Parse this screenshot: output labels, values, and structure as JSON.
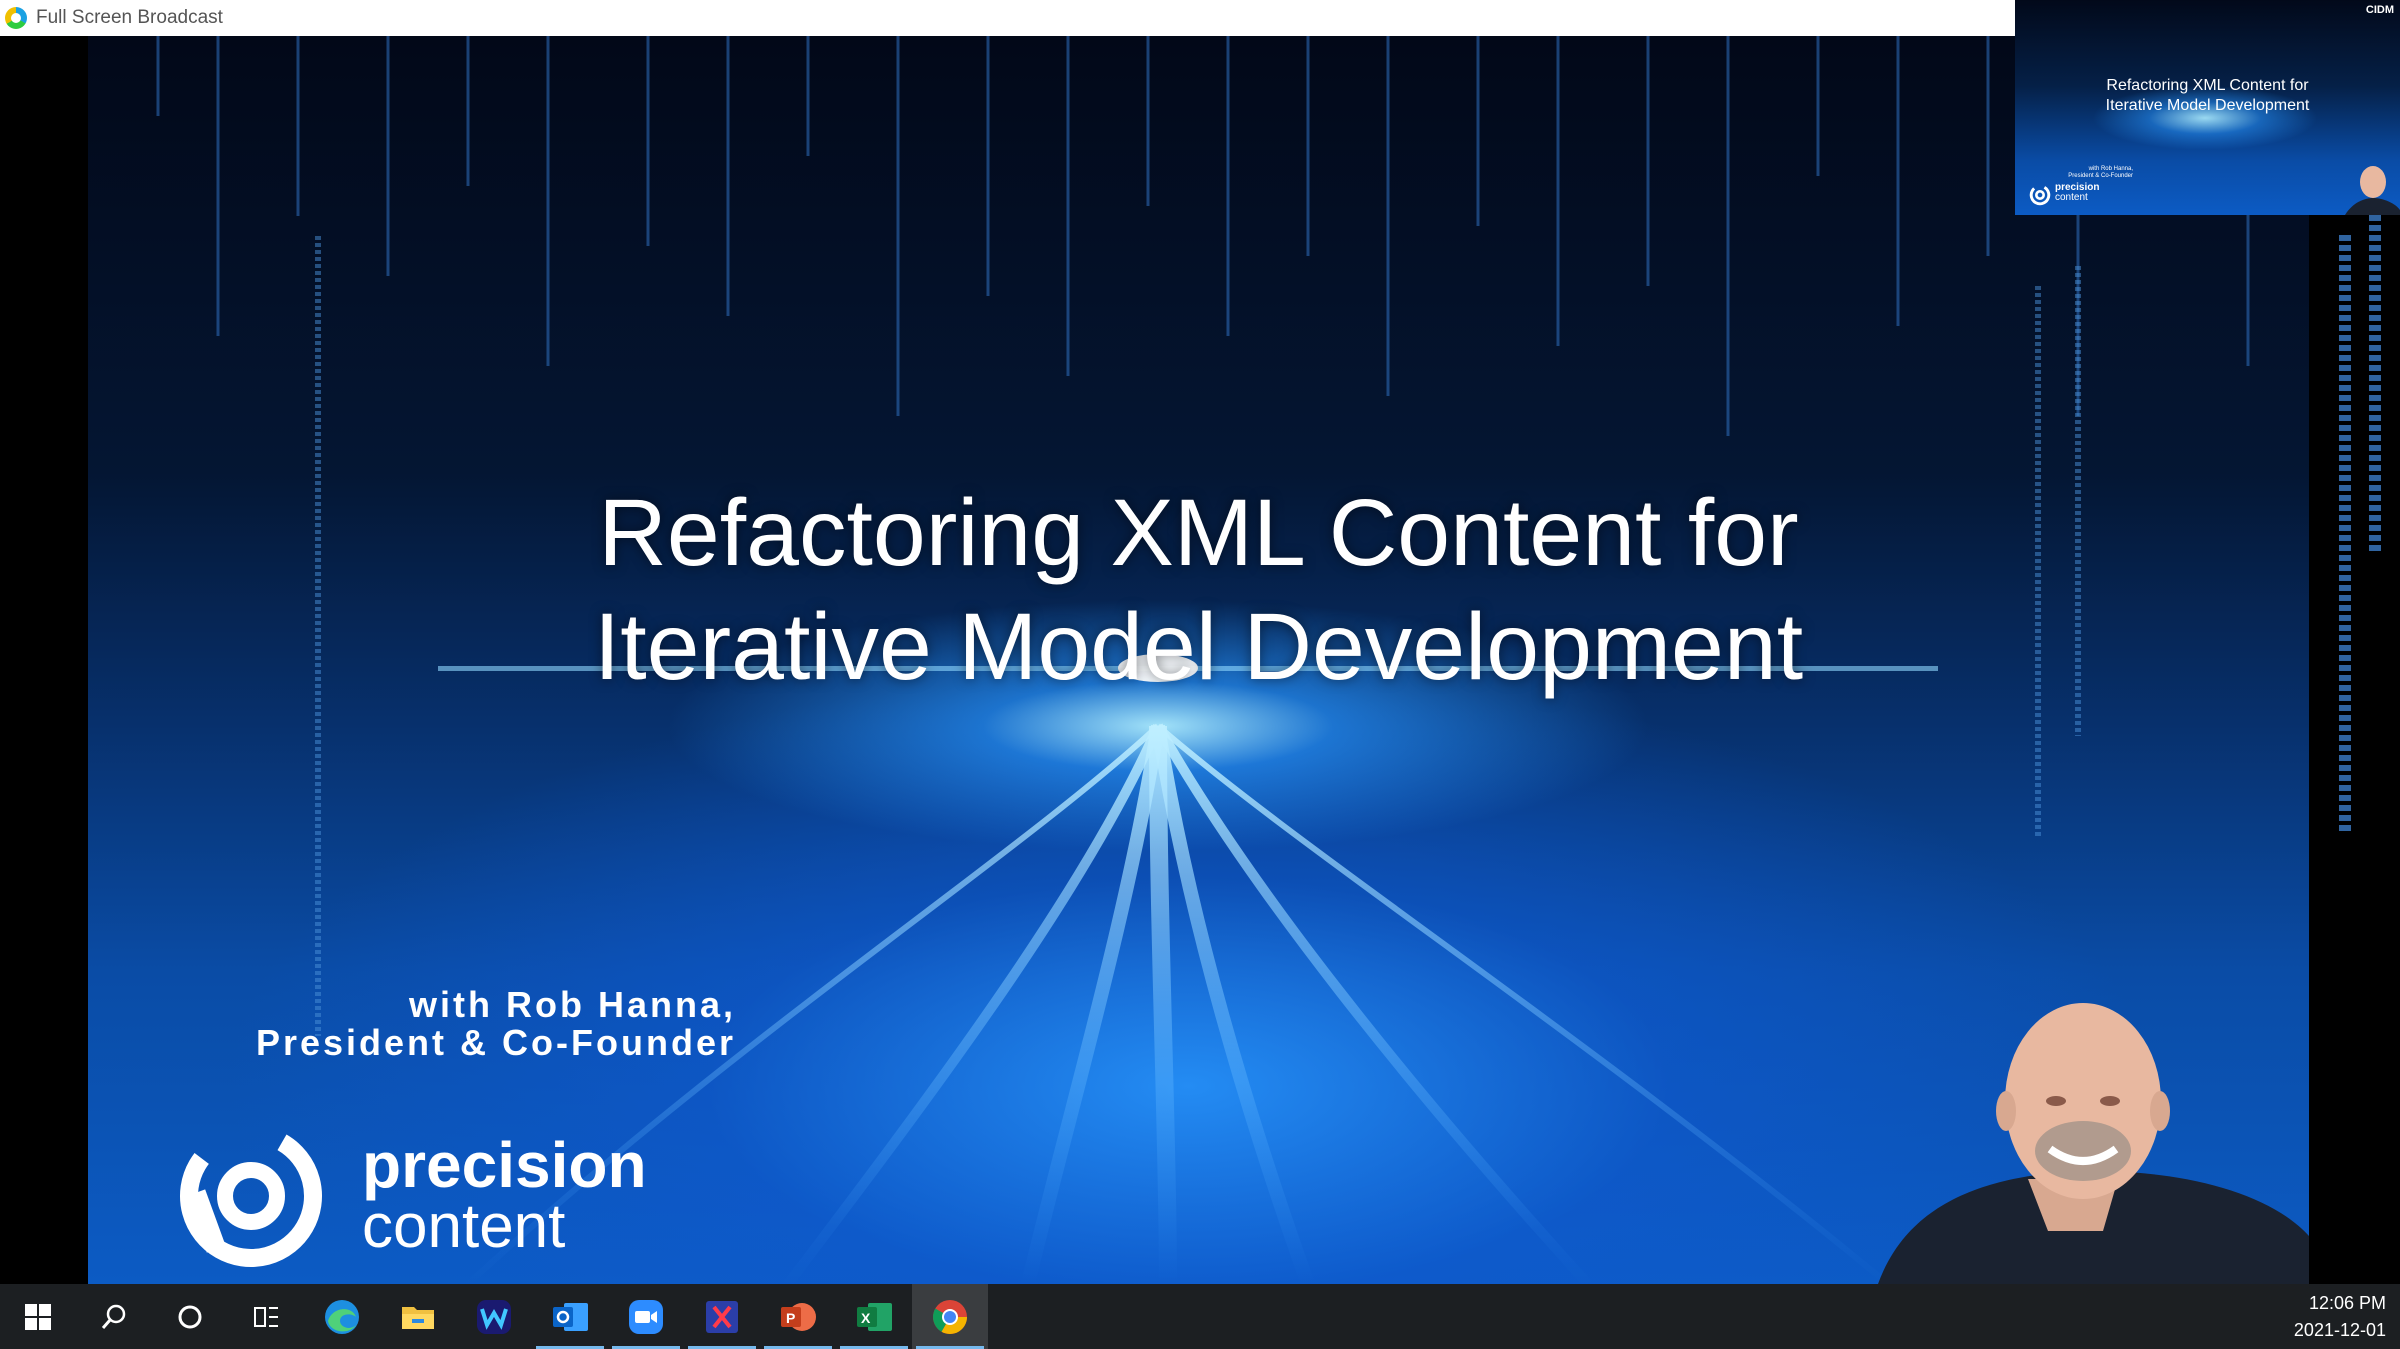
{
  "window": {
    "title": "Full Screen Broadcast"
  },
  "slide": {
    "title_line1": "Refactoring XML Content for",
    "title_line2": "Iterative Model Development",
    "presenter_line1": "with Rob Hanna,",
    "presenter_line2": "President & Co-Founder",
    "brand_word1": "precision",
    "brand_word2": "content"
  },
  "thumbnail": {
    "title_line1": "Refactoring XML Content for",
    "title_line2": "Iterative Model Development",
    "badge": "CIDM",
    "presenter_line1": "with Rob Hanna,",
    "presenter_line2": "President & Co-Founder",
    "brand_word1": "precision",
    "brand_word2": "content"
  },
  "taskbar": {
    "apps": [
      {
        "name": "start-icon"
      },
      {
        "name": "search-icon"
      },
      {
        "name": "cortana-icon"
      },
      {
        "name": "task-view-icon"
      },
      {
        "name": "edge-icon"
      },
      {
        "name": "file-explorer-icon"
      },
      {
        "name": "webex-icon"
      },
      {
        "name": "outlook-icon"
      },
      {
        "name": "zoom-icon"
      },
      {
        "name": "xmind-icon"
      },
      {
        "name": "powerpoint-icon"
      },
      {
        "name": "excel-icon"
      },
      {
        "name": "chrome-icon"
      }
    ],
    "clock_time": "12:06 PM",
    "clock_date": "2021-12-01"
  },
  "colors": {
    "accent": "#0c5bc4",
    "taskbar": "#1c1f22",
    "active_indicator": "#76b9ed"
  }
}
